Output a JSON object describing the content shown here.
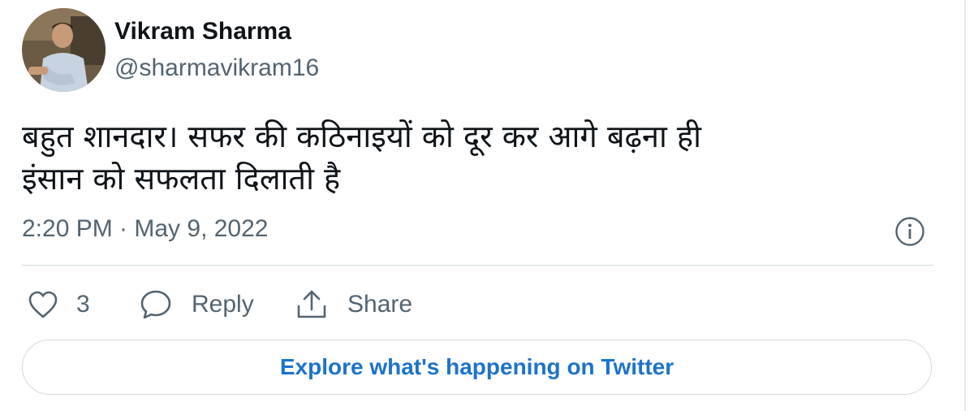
{
  "author": {
    "name": "Vikram Sharma",
    "handle": "@sharmavikram16"
  },
  "tweet": {
    "text_line1": "बहुत शानदार। सफर की कठिनाइयों को दूर कर आगे बढ़ना ही",
    "text_line2": "इंसान को सफलता दिलाती है",
    "timestamp": "2:20 PM · May 9, 2022"
  },
  "actions": {
    "like_icon": "heart-icon",
    "like_count": "3",
    "reply_icon": "speech-bubble-icon",
    "reply_label": "Reply",
    "share_icon": "share-upload-icon",
    "share_label": "Share"
  },
  "info_icon": "info-circle-icon",
  "explore": {
    "label": "Explore what's happening on Twitter"
  },
  "colors": {
    "text_primary": "#0f1419",
    "text_secondary": "#536471",
    "link_blue": "#1d73c9",
    "border": "#cfd9de"
  }
}
